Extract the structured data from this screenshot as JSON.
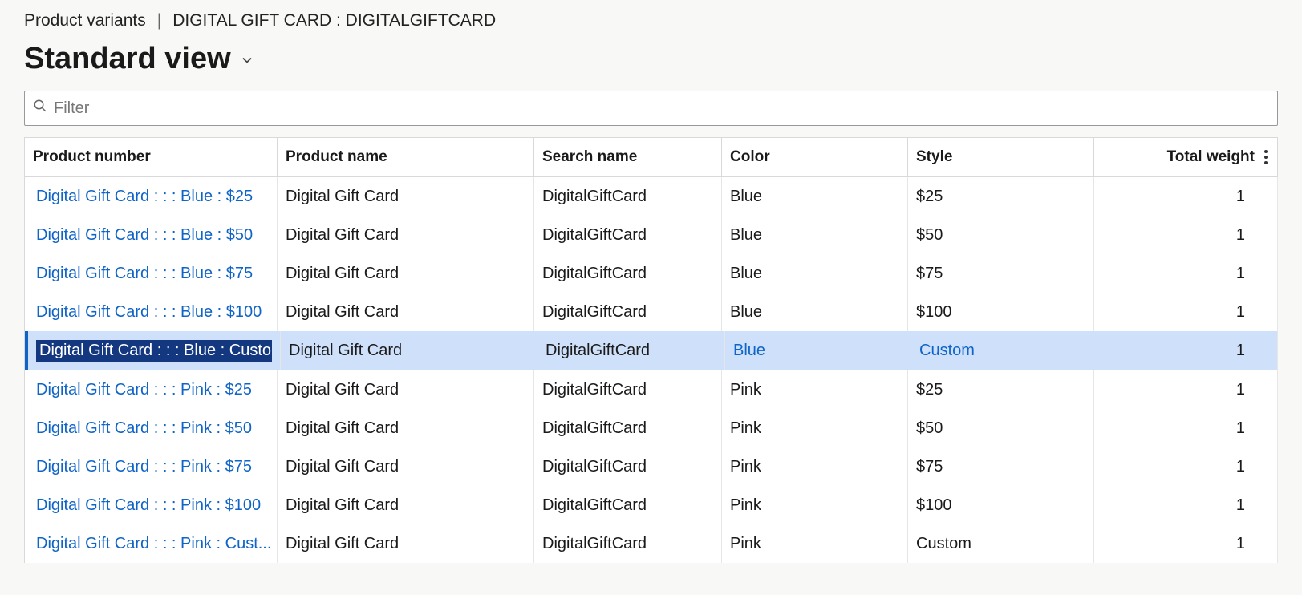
{
  "breadcrumb": {
    "root": "Product variants",
    "item": "DIGITAL GIFT CARD : DIGITALGIFTCARD"
  },
  "view_title": "Standard view",
  "filter": {
    "placeholder": "Filter",
    "value": ""
  },
  "columns": {
    "product_number": "Product number",
    "product_name": "Product name",
    "search_name": "Search name",
    "color": "Color",
    "style": "Style",
    "total_weight": "Total weight"
  },
  "rows": [
    {
      "product_number": "Digital Gift Card :  :  : Blue : $25",
      "product_name": "Digital Gift Card",
      "search_name": "DigitalGiftCard",
      "color": "Blue",
      "style": "$25",
      "total_weight": "1",
      "selected": false
    },
    {
      "product_number": "Digital Gift Card :  :  : Blue : $50",
      "product_name": "Digital Gift Card",
      "search_name": "DigitalGiftCard",
      "color": "Blue",
      "style": "$50",
      "total_weight": "1",
      "selected": false
    },
    {
      "product_number": "Digital Gift Card :  :  : Blue : $75",
      "product_name": "Digital Gift Card",
      "search_name": "DigitalGiftCard",
      "color": "Blue",
      "style": "$75",
      "total_weight": "1",
      "selected": false
    },
    {
      "product_number": "Digital Gift Card :  :  : Blue : $100",
      "product_name": "Digital Gift Card",
      "search_name": "DigitalGiftCard",
      "color": "Blue",
      "style": "$100",
      "total_weight": "1",
      "selected": false
    },
    {
      "product_number": "Digital Gift Card :  :  : Blue : Custom",
      "product_name": "Digital Gift Card",
      "search_name": "DigitalGiftCard",
      "color": "Blue",
      "style": "Custom",
      "total_weight": "1",
      "selected": true
    },
    {
      "product_number": "Digital Gift Card :  :  : Pink : $25",
      "product_name": "Digital Gift Card",
      "search_name": "DigitalGiftCard",
      "color": "Pink",
      "style": "$25",
      "total_weight": "1",
      "selected": false
    },
    {
      "product_number": "Digital Gift Card :  :  : Pink : $50",
      "product_name": "Digital Gift Card",
      "search_name": "DigitalGiftCard",
      "color": "Pink",
      "style": "$50",
      "total_weight": "1",
      "selected": false
    },
    {
      "product_number": "Digital Gift Card :  :  : Pink : $75",
      "product_name": "Digital Gift Card",
      "search_name": "DigitalGiftCard",
      "color": "Pink",
      "style": "$75",
      "total_weight": "1",
      "selected": false
    },
    {
      "product_number": "Digital Gift Card :  :  : Pink : $100",
      "product_name": "Digital Gift Card",
      "search_name": "DigitalGiftCard",
      "color": "Pink",
      "style": "$100",
      "total_weight": "1",
      "selected": false
    },
    {
      "product_number": "Digital Gift Card :  :  : Pink : Cust...",
      "product_name": "Digital Gift Card",
      "search_name": "DigitalGiftCard",
      "color": "Pink",
      "style": "Custom",
      "total_weight": "1",
      "selected": false
    }
  ]
}
